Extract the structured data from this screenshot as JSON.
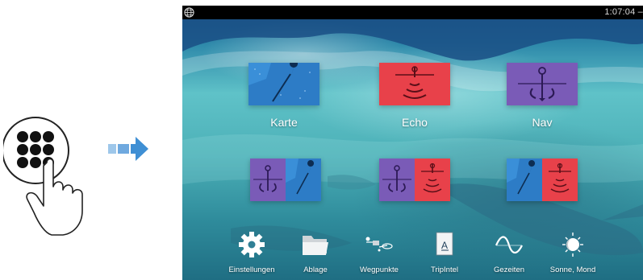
{
  "statusbar": {
    "time": "1:07:04 –"
  },
  "apps": [
    {
      "label": "Karte"
    },
    {
      "label": "Echo"
    },
    {
      "label": "Nav"
    }
  ],
  "tools": [
    {
      "label": "Einstellungen",
      "icon": "gear-icon"
    },
    {
      "label": "Ablage",
      "icon": "folder-icon"
    },
    {
      "label": "Wegpunkte",
      "icon": "waypoints-icon"
    },
    {
      "label": "TripIntel",
      "icon": "tripintel-icon"
    },
    {
      "label": "Gezeiten",
      "icon": "tides-icon"
    },
    {
      "label": "Sonne, Mond",
      "icon": "sun-moon-icon"
    }
  ],
  "colors": {
    "chart_blue": "#3a8fd8",
    "echo_red": "#e8414a",
    "nav_purple": "#7a5bb7",
    "arrow_blue": "#3f8fd4"
  }
}
